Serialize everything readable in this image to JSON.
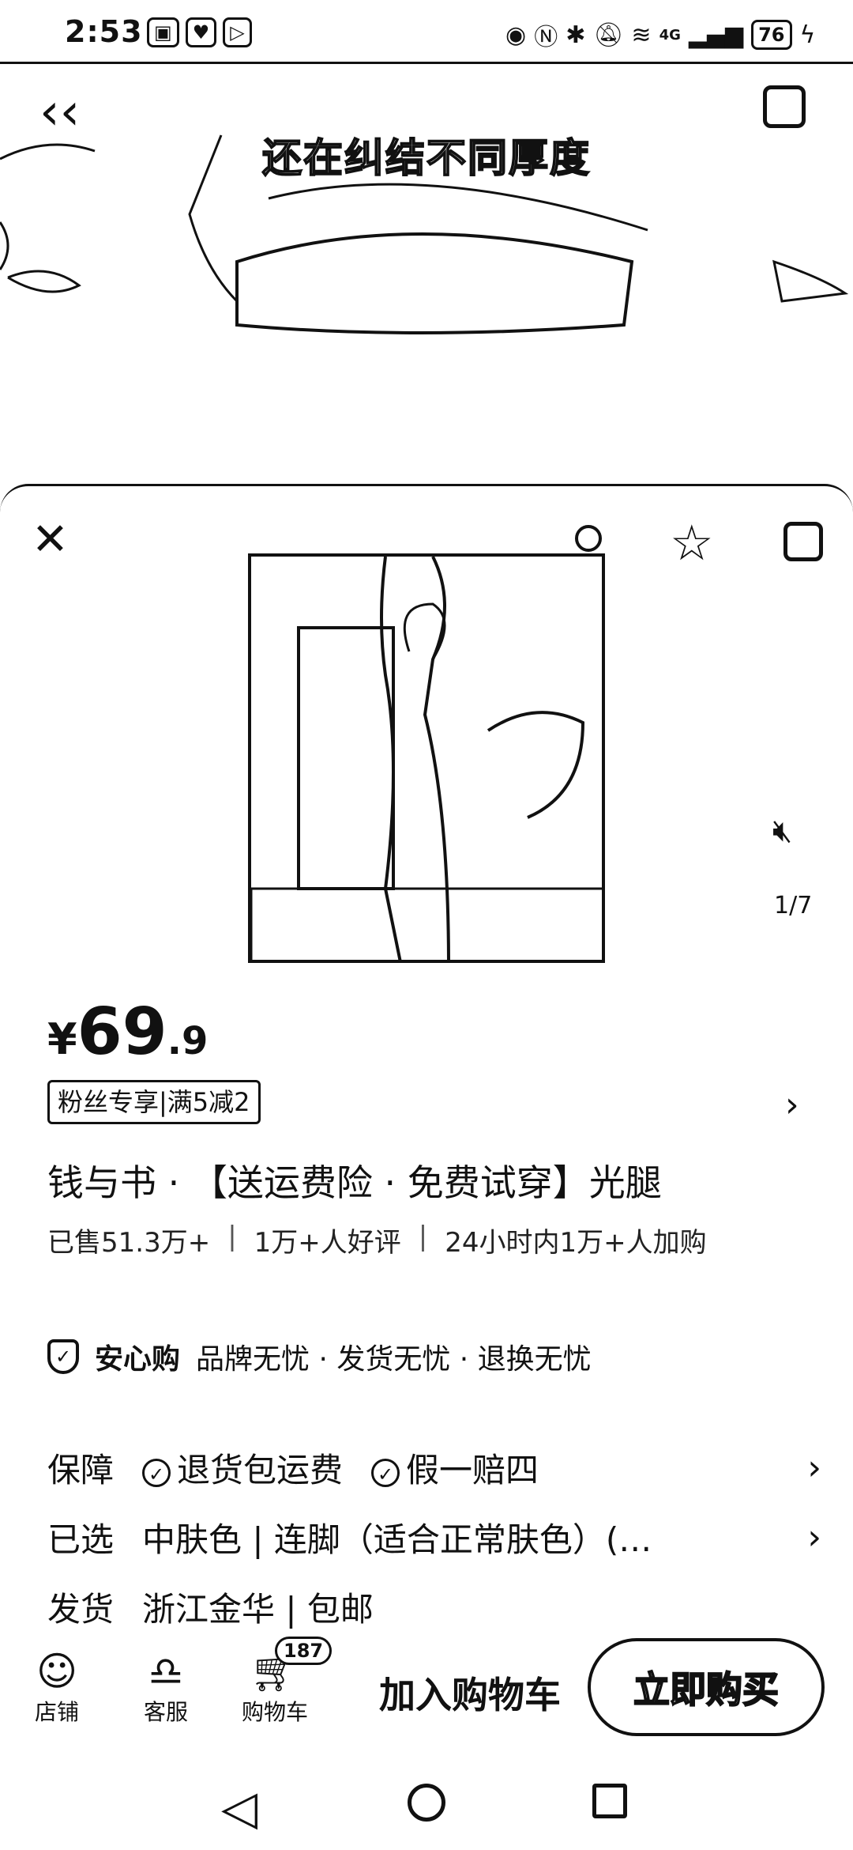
{
  "status": {
    "time": "2:53",
    "network": "4G",
    "battery": "76"
  },
  "video": {
    "caption": "还在纠结不同厚度"
  },
  "media": {
    "counter": "1/7"
  },
  "price": {
    "symbol": "¥",
    "integer": "69",
    "decimal": ".9"
  },
  "promo": {
    "tag": "粉丝专享|满5减2"
  },
  "product": {
    "title": "钱与书 · 【送运费险 · 免费试穿】光腿",
    "sold": "已售51.3万+",
    "reviews": "1万+人好评",
    "added": "24小时内1万+人加购"
  },
  "assurance": {
    "label": "安心购",
    "text": "品牌无忧 · 发货无忧 · 退换无忧"
  },
  "guarantee": {
    "label": "保障",
    "item1": "退货包运费",
    "item2": "假一赔四"
  },
  "selected": {
    "label": "已选",
    "value": "中肤色 | 连脚（适合正常肤色）(…"
  },
  "shipping": {
    "label": "发货",
    "value": "浙江金华 | 包邮"
  },
  "bottom": {
    "shop": "店铺",
    "service": "客服",
    "cart": "购物车",
    "cart_count": "187",
    "add_to_cart": "加入购物车",
    "buy_now": "立即购买"
  }
}
